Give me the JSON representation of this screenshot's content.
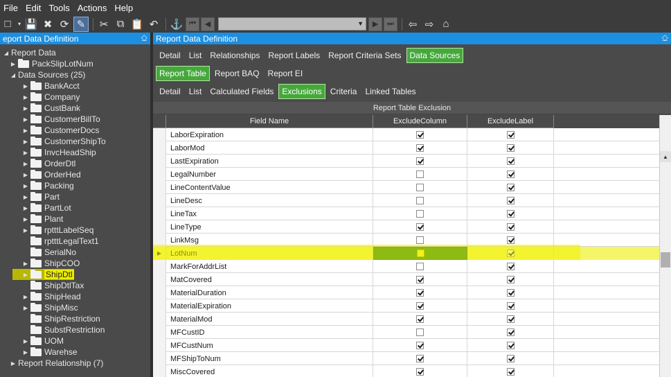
{
  "menu": [
    "File",
    "Edit",
    "Tools",
    "Actions",
    "Help"
  ],
  "left_panel": {
    "title": "eport Data Definition",
    "pin": "⎐",
    "tree": [
      {
        "label": "Report Data",
        "level": 0,
        "expanded": true,
        "folder": false
      },
      {
        "label": "PackSlipLotNum",
        "level": 1,
        "expanded": false,
        "folder": true
      },
      {
        "label": "Data Sources (25)",
        "level": 1,
        "expanded": true,
        "folder": false
      },
      {
        "label": "BankAcct",
        "level": 2,
        "folder": true
      },
      {
        "label": "Company",
        "level": 2,
        "folder": true
      },
      {
        "label": "CustBank",
        "level": 2,
        "folder": true
      },
      {
        "label": "CustomerBillTo",
        "level": 2,
        "folder": true
      },
      {
        "label": "CustomerDocs",
        "level": 2,
        "folder": true
      },
      {
        "label": "CustomerShipTo",
        "level": 2,
        "folder": true
      },
      {
        "label": "InvcHeadShip",
        "level": 2,
        "folder": true
      },
      {
        "label": "OrderDtl",
        "level": 2,
        "folder": true
      },
      {
        "label": "OrderHed",
        "level": 2,
        "folder": true
      },
      {
        "label": "Packing",
        "level": 2,
        "folder": true
      },
      {
        "label": "Part",
        "level": 2,
        "folder": true
      },
      {
        "label": "PartLot",
        "level": 2,
        "folder": true
      },
      {
        "label": "Plant",
        "level": 2,
        "folder": true
      },
      {
        "label": "rptttLabelSeq",
        "level": 2,
        "folder": true
      },
      {
        "label": "rptttLegalText1",
        "level": 2,
        "folder": true,
        "noarrow": true
      },
      {
        "label": "SerialNo",
        "level": 2,
        "folder": true,
        "noarrow": true
      },
      {
        "label": "ShipCOO",
        "level": 2,
        "folder": true
      },
      {
        "label": "ShipDtl",
        "level": 2,
        "folder": true,
        "highlight": true
      },
      {
        "label": "ShipDtlTax",
        "level": 2,
        "folder": true,
        "noarrow": true
      },
      {
        "label": "ShipHead",
        "level": 2,
        "folder": true
      },
      {
        "label": "ShipMisc",
        "level": 2,
        "folder": true
      },
      {
        "label": "ShipRestriction",
        "level": 2,
        "folder": true,
        "noarrow": true
      },
      {
        "label": "SubstRestriction",
        "level": 2,
        "folder": true,
        "noarrow": true
      },
      {
        "label": "UOM",
        "level": 2,
        "folder": true
      },
      {
        "label": "Warehse",
        "level": 2,
        "folder": true
      },
      {
        "label": "Report Relationship (7)",
        "level": 1,
        "expanded": false,
        "folder": false
      }
    ]
  },
  "right_panel": {
    "title": "Report Data Definition",
    "pin": "⎐",
    "tabs1": [
      {
        "label": "Detail",
        "active": false
      },
      {
        "label": "List",
        "active": false
      },
      {
        "label": "Relationships",
        "active": false
      },
      {
        "label": "Report Labels",
        "active": false
      },
      {
        "label": "Report Criteria Sets",
        "active": false
      },
      {
        "label": "Data Sources",
        "active": true
      }
    ],
    "tabs2": [
      {
        "label": "Report Table",
        "active": true
      },
      {
        "label": "Report BAQ",
        "active": false
      },
      {
        "label": "Report EI",
        "active": false
      }
    ],
    "tabs3": [
      {
        "label": "Detail",
        "active": false
      },
      {
        "label": "List",
        "active": false
      },
      {
        "label": "Calculated Fields",
        "active": false
      },
      {
        "label": "Exclusions",
        "active": true
      },
      {
        "label": "Criteria",
        "active": false
      },
      {
        "label": "Linked Tables",
        "active": false
      }
    ],
    "grid": {
      "title": "Report Table Exclusion",
      "columns": [
        "Field Name",
        "ExcludeColumn",
        "ExcludeLabel"
      ],
      "rows": [
        {
          "name": "LaborExpiration",
          "exclude_column": true,
          "exclude_label": true
        },
        {
          "name": "LaborMod",
          "exclude_column": true,
          "exclude_label": true
        },
        {
          "name": "LastExpiration",
          "exclude_column": true,
          "exclude_label": true
        },
        {
          "name": "LegalNumber",
          "exclude_column": false,
          "exclude_label": true
        },
        {
          "name": "LineContentValue",
          "exclude_column": false,
          "exclude_label": true
        },
        {
          "name": "LineDesc",
          "exclude_column": false,
          "exclude_label": true
        },
        {
          "name": "LineTax",
          "exclude_column": false,
          "exclude_label": true
        },
        {
          "name": "LineType",
          "exclude_column": true,
          "exclude_label": true
        },
        {
          "name": "LinkMsg",
          "exclude_column": false,
          "exclude_label": true
        },
        {
          "name": "LotNum",
          "exclude_column": false,
          "exclude_label": true,
          "current": true
        },
        {
          "name": "MarkForAddrList",
          "exclude_column": false,
          "exclude_label": true
        },
        {
          "name": "MatCovered",
          "exclude_column": true,
          "exclude_label": true
        },
        {
          "name": "MaterialDuration",
          "exclude_column": true,
          "exclude_label": true
        },
        {
          "name": "MaterialExpiration",
          "exclude_column": true,
          "exclude_label": true
        },
        {
          "name": "MaterialMod",
          "exclude_column": true,
          "exclude_label": true
        },
        {
          "name": "MFCustID",
          "exclude_column": false,
          "exclude_label": true
        },
        {
          "name": "MFCustNum",
          "exclude_column": true,
          "exclude_label": true
        },
        {
          "name": "MFShipToNum",
          "exclude_column": true,
          "exclude_label": true
        },
        {
          "name": "MiscCovered",
          "exclude_column": true,
          "exclude_label": true
        }
      ]
    }
  },
  "colors": {
    "accent_blue": "#1c8fe0",
    "active_tab_green": "#46a83c",
    "highlight_yellow": "#ecec00"
  }
}
